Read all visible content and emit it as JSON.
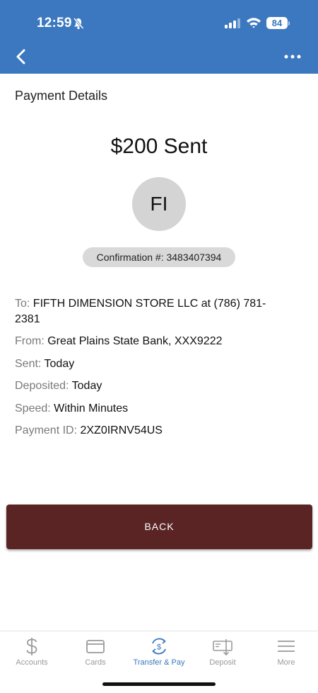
{
  "status_bar": {
    "time": "12:59",
    "battery": "84"
  },
  "header": {
    "back_icon": "chevron-left-icon",
    "more_icon": "ellipsis-icon"
  },
  "page": {
    "title": "Payment Details",
    "amount_title": "$200 Sent",
    "avatar_initials": "FI",
    "confirmation": "Confirmation #: 3483407394"
  },
  "details": {
    "to_label": "To:",
    "to_value": "FIFTH DIMENSION STORE LLC at (786) 781-",
    "to_value_cont": "2381",
    "from_label": "From:",
    "from_value": "Great Plains State Bank, XXX9222",
    "sent_label": "Sent:",
    "sent_value": "Today",
    "deposited_label": "Deposited:",
    "deposited_value": "Today",
    "speed_label": "Speed:",
    "speed_value": "Within Minutes",
    "payment_id_label": "Payment ID:",
    "payment_id_value": "2XZ0IRNV54US"
  },
  "actions": {
    "back_label": "BACK"
  },
  "tabbar": {
    "tabs": [
      {
        "label": "Accounts",
        "icon": "dollar-icon",
        "active": false
      },
      {
        "label": "Cards",
        "icon": "card-icon",
        "active": false
      },
      {
        "label": "Transfer & Pay",
        "icon": "transfer-icon",
        "active": true
      },
      {
        "label": "Deposit",
        "icon": "check-deposit-icon",
        "active": false
      },
      {
        "label": "More",
        "icon": "menu-icon",
        "active": false
      }
    ]
  },
  "colors": {
    "header_bg": "#3b78bf",
    "button_bg": "#5a2424",
    "active_tab": "#3b78bf",
    "inactive_tab": "#9a9a9a"
  }
}
